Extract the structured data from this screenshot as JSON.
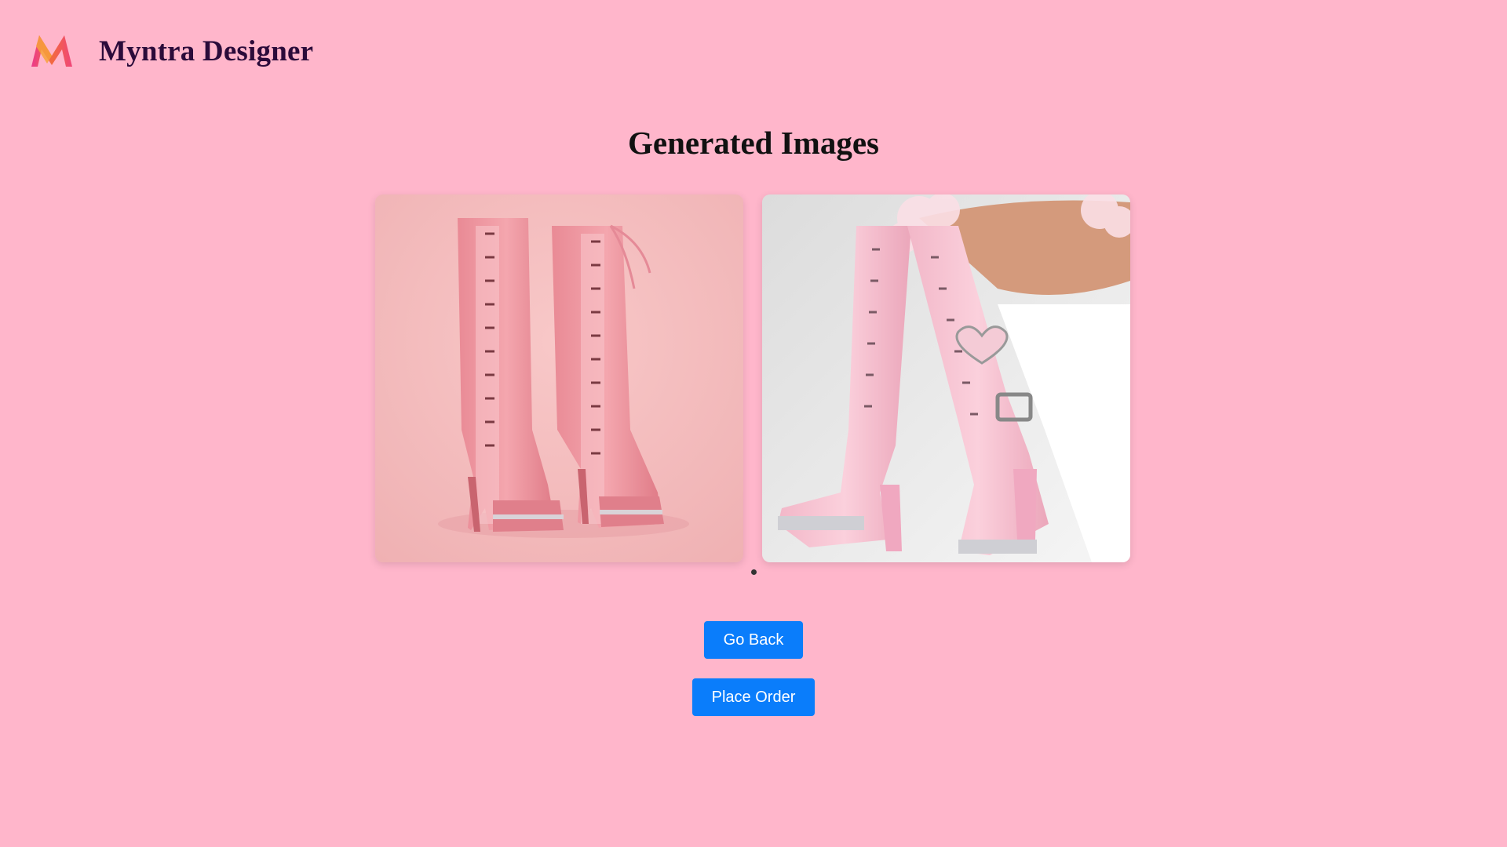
{
  "header": {
    "logo_icon": "myntra-m-logo-icon",
    "brand": "Myntra Designer"
  },
  "main": {
    "title": "Generated Images",
    "images": [
      {
        "icon": "pink-lace-up-platform-boots-image"
      },
      {
        "icon": "pink-knee-high-buckle-boots-image"
      }
    ],
    "carousel_dots": 1
  },
  "actions": {
    "go_back_label": "Go Back",
    "place_order_label": "Place Order"
  },
  "colors": {
    "background": "#ffb6cb",
    "button": "#0a7dfb",
    "brand_text": "#2b0b3a"
  }
}
